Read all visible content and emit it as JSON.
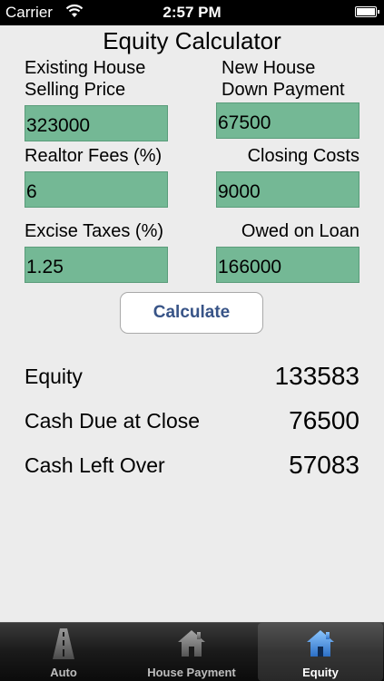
{
  "status": {
    "carrier": "Carrier",
    "time": "2:57 PM"
  },
  "title": "Equity Calculator",
  "inputs": {
    "existing_price": {
      "label_line1": "Existing House",
      "label_line2": "Selling Price",
      "value": "323000"
    },
    "down_payment": {
      "label_line1": "New House",
      "label_line2": "Down Payment",
      "value": "67500"
    },
    "realtor_fees": {
      "label": "Realtor Fees (%)",
      "value": "6"
    },
    "closing_costs": {
      "label": "Closing Costs",
      "value": "9000"
    },
    "excise_taxes": {
      "label": "Excise Taxes (%)",
      "value": "1.25"
    },
    "owed_on_loan": {
      "label": "Owed on Loan",
      "value": "166000"
    }
  },
  "calculate_label": "Calculate",
  "results": [
    {
      "label": "Equity",
      "value": "133583"
    },
    {
      "label": "Cash Due at Close",
      "value": "76500"
    },
    {
      "label": "Cash Left Over",
      "value": "57083"
    }
  ],
  "tabs": [
    {
      "label": "Auto",
      "icon": "road-icon",
      "active": false
    },
    {
      "label": "House Payment",
      "icon": "house-icon",
      "active": false
    },
    {
      "label": "Equity",
      "icon": "house-icon",
      "active": true
    }
  ],
  "colors": {
    "field_bg": "#74b895",
    "button_text": "#385487",
    "active_icon": "#4a90d9"
  }
}
